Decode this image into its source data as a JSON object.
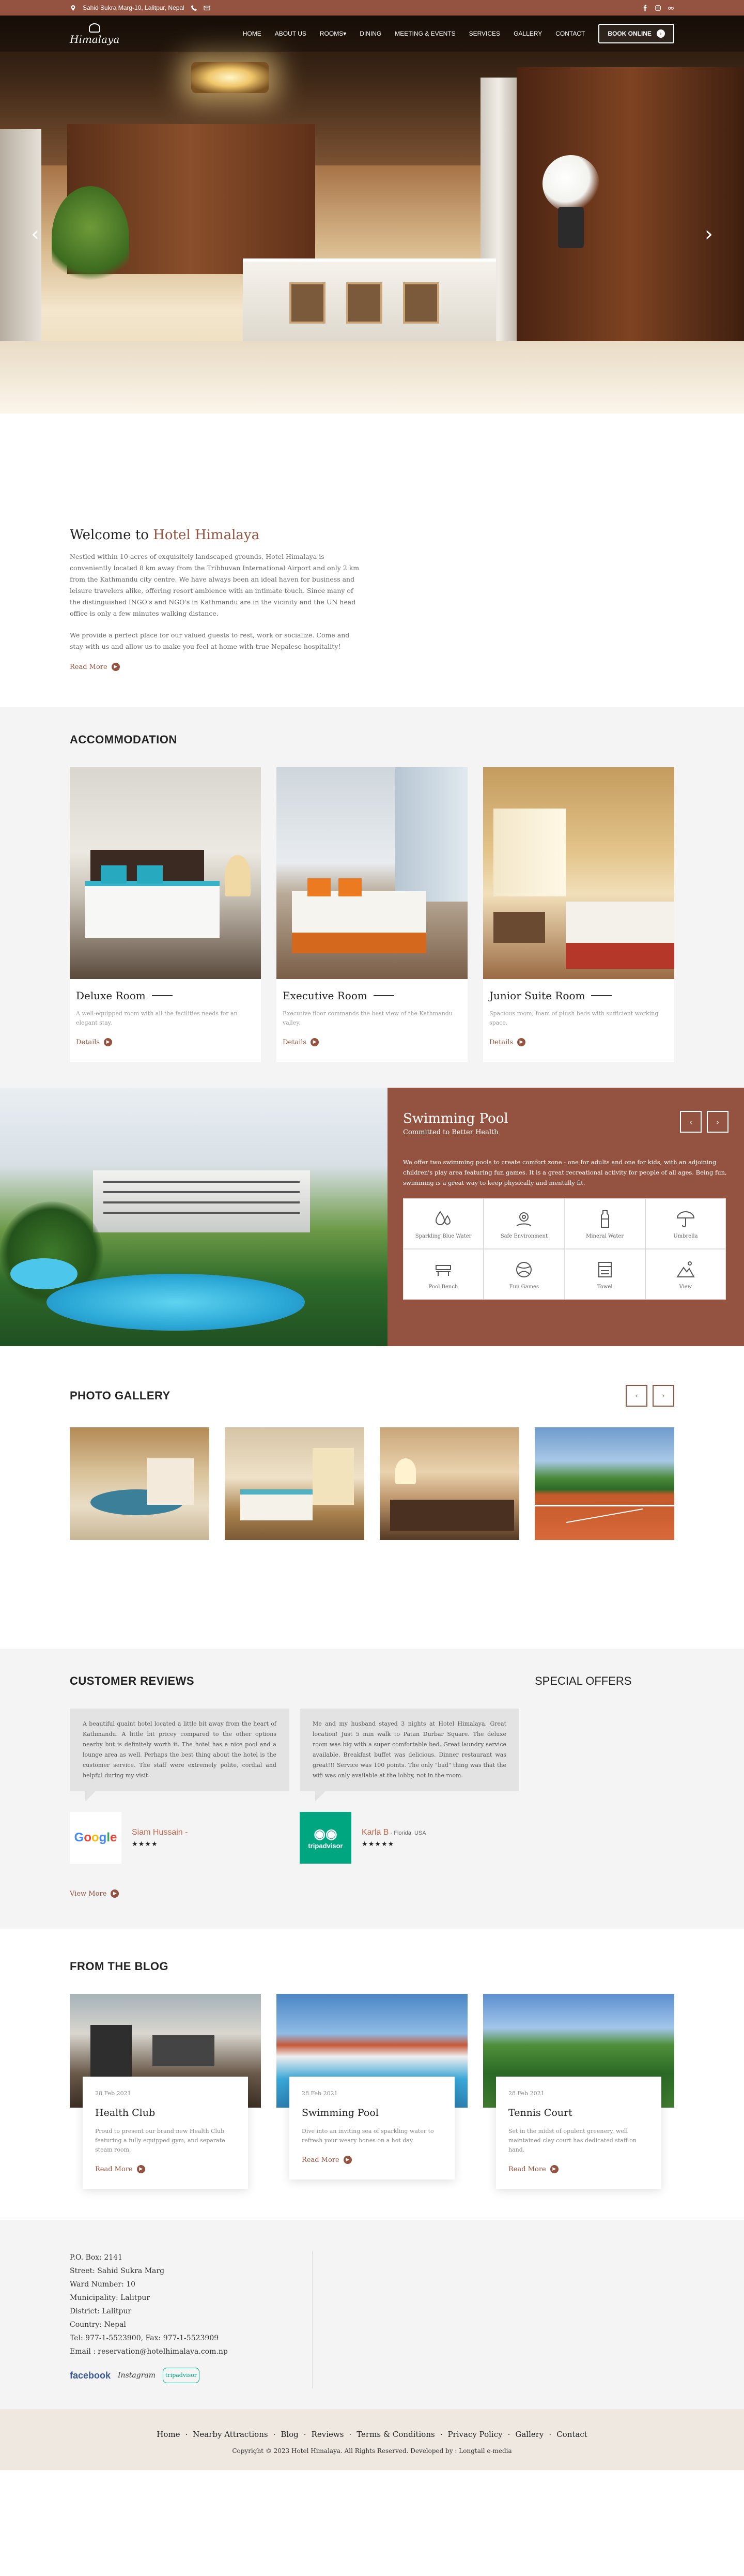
{
  "topbar": {
    "address": "Sahid Sukra Marg-10, Lalitpur, Nepal",
    "social": [
      "facebook-icon",
      "instagram-icon",
      "tripadvisor-icon"
    ]
  },
  "nav": {
    "logo_text": "Himalaya",
    "items": [
      "HOME",
      "ABOUT US",
      "ROOMS",
      "DINING",
      "MEETING & EVENTS",
      "SERVICES",
      "GALLERY",
      "CONTACT"
    ],
    "book_label": "BOOK ONLINE"
  },
  "welcome": {
    "title_prefix": "Welcome to ",
    "title_brand": "Hotel Himalaya",
    "p1": "Nestled within 10 acres of exquisitely landscaped grounds, Hotel Himalaya is conveniently located 8 km away from the Tribhuvan International Airport and only 2 km from the Kathmandu city centre. We have always been an ideal haven for business and leisure travelers alike, offering resort ambience with an intimate touch. Since many of the distinguished INGO's and NGO's in Kathmandu are in the vicinity and the UN head office is only a few minutes walking distance.",
    "p2": "We provide a perfect place for our valued guests to rest, work or socialize. Come and stay with us and allow us to make you feel at home with true Nepalese hospitality!",
    "read_more": "Read More"
  },
  "accommodation": {
    "title": "ACCOMMODATION",
    "rooms": [
      {
        "name": "Deluxe Room",
        "desc": "A well-equipped room with all the facilities needs for an elegant stay.",
        "link": "Details"
      },
      {
        "name": "Executive Room",
        "desc": "Executive floor commands the best view of the Kathmandu valley.",
        "link": "Details"
      },
      {
        "name": "Junior Suite Room",
        "desc": "Spacious room, foam of plush beds with sufficient working space.",
        "link": "Details"
      }
    ]
  },
  "pool": {
    "title": "Swimming Pool",
    "subtitle": "Committed to Better Health",
    "text": "We offer two swimming pools to create comfort zone - one for adults and one for kids, with an adjoining children's play area featuring fun games. It is a great recreational activity for people of all ages. Being fun, swimming is a great way to keep physically and mentally fit.",
    "amenities": [
      "Sparkling Blue Water",
      "Safe Environment",
      "Mineral Water",
      "Umbrella",
      "Pool Bench",
      "Fun Games",
      "Towel",
      "View"
    ]
  },
  "gallery": {
    "title": "PHOTO GALLERY"
  },
  "reviews": {
    "title": "CUSTOMER REVIEWS",
    "offers_title": "SPECIAL OFFERS",
    "items": [
      {
        "text": "A beautiful quaint hotel located a little bit away from the heart of Kathmandu. A little bit pricey compared to the other options nearby but is definitely worth it. The hotel has a nice pool and a lounge area as well. Perhaps the best thing about the hotel is the customer service. The staff were extremely polite, cordial and helpful during my visit.",
        "name": "Siam Hussain -",
        "location": "",
        "source": "Google",
        "stars": "★★★★"
      },
      {
        "text": "Me and my husband stayed 3 nights at Hotel Himalaya. Great location! Just 5 min walk to Patan Durbar Square. The deluxe room was big with a super comfortable bed. Great laundry service available. Breakfast buffet was delicious. Dinner restaurant was great!!! Service was 100 points. The only \"bad\" thing was that the wifi was only available at the lobby, not in the room.",
        "name": "Karla B",
        "location": " - Florida, USA",
        "source": "tripadvisor",
        "stars": "★★★★★"
      }
    ],
    "view_more": "View More"
  },
  "blog": {
    "title": "FROM THE BLOG",
    "posts": [
      {
        "date": "28 Feb 2021",
        "title": "Health Club",
        "text": "Proud to present our brand new Health Club featuring a fully equipped gym, and separate steam room.",
        "link": "Read More"
      },
      {
        "date": "28 Feb 2021",
        "title": "Swimming Pool",
        "text": "Dive into an inviting sea of sparkling water to refresh your weary bones on a hot day.",
        "link": "Read More"
      },
      {
        "date": "28 Feb 2021",
        "title": "Tennis Court",
        "text": "Set in the midst of opulent greenery, well maintained clay court has dedicated staff on hand.",
        "link": "Read More"
      }
    ]
  },
  "footer": {
    "address": [
      "P.O. Box: 2141",
      "Street: Sahid Sukra Marg",
      "Ward Number: 10",
      "Municipality: Lalitpur",
      "District: Lalitpur",
      "Country: Nepal",
      "Tel: 977-1-5523900, Fax: 977-1-5523909",
      "Email : reservation@hotelhimalaya.com.np"
    ],
    "social": {
      "facebook": "facebook",
      "instagram": "Instagram",
      "tripadvisor": "tripadvisor"
    },
    "links": [
      "Home",
      "Nearby Attractions",
      "Blog",
      "Reviews",
      "Terms & Conditions",
      "Privacy Policy",
      "Gallery",
      "Contact"
    ],
    "copyright": "Copyright © 2023 Hotel Himalaya. All Rights Reserved. Developed by : Longtail e-media"
  },
  "colors": {
    "brand": "#935340",
    "footer_bottom": "#efe8e0",
    "section_grey": "#f4f4f4"
  }
}
